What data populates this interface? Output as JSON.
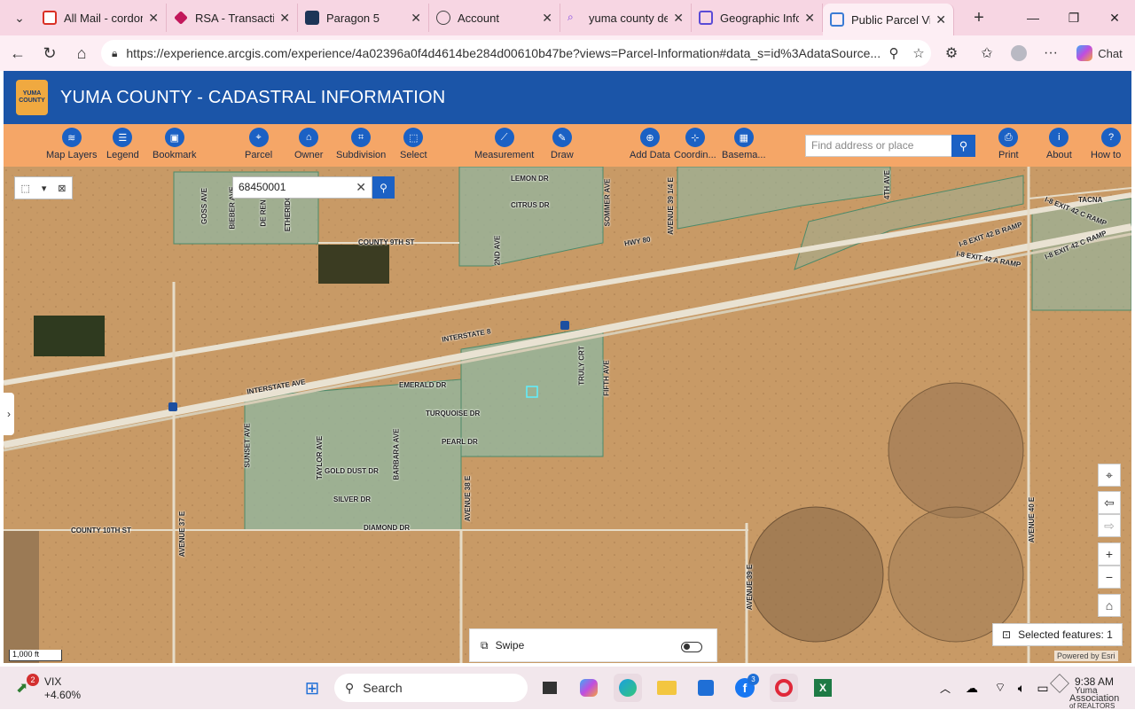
{
  "browser": {
    "tabs": [
      {
        "label": "All Mail - cordom",
        "icon": "gmail-icon",
        "color": "#d93025"
      },
      {
        "label": "RSA - Transaction",
        "icon": "rsa-icon",
        "color": "#c2185b"
      },
      {
        "label": "Paragon 5",
        "icon": "paragon-icon",
        "color": "#1d3557"
      },
      {
        "label": "Account",
        "icon": "globe-icon",
        "color": "#555555"
      },
      {
        "label": "yuma county dev",
        "icon": "search-icon",
        "color": "#7b3fe4"
      },
      {
        "label": "Geographic Infor",
        "icon": "window-icon",
        "color": "#5a4bd6"
      },
      {
        "label": "Public Parcel Vie",
        "icon": "window-icon",
        "color": "#3a7bd5"
      }
    ],
    "url": "https://experience.arcgis.com/experience/4a02396a0f4d4614be284d00610b47be?views=Parcel-Information#data_s=id%3AdataSource...",
    "chat_label": "Chat"
  },
  "app": {
    "logo_text": "YUMA COUNTY",
    "title": "YUMA COUNTY - CADASTRAL INFORMATION",
    "tools": [
      "Map Layers",
      "Legend",
      "Bookmark",
      "Parcel",
      "Owner",
      "Subdivision",
      "Select",
      "Measurement",
      "Draw",
      "Add Data",
      "Coordin...",
      "Basema...",
      "Print",
      "About",
      "How to ..."
    ],
    "address_placeholder": "Find address or place",
    "accent": "#1b61c4",
    "toolbar_color": "#f5a667",
    "header_color": "#1b55a8"
  },
  "map": {
    "parcel_search_value": "68450001",
    "road_labels": [
      "LEMON DR",
      "CITRUS DR",
      "GOSS AVE",
      "BIEBER AVE",
      "DE REN",
      "ETHERIDG",
      "COUNTY 9TH ST",
      "2ND AVE",
      "SOMMER AVE",
      "AVENUE 39 1/4 E",
      "4TH AVE",
      "HWY 80",
      "TACNA",
      "I-8 EXIT 42 C RAMP",
      "I-8 EXIT 42 B RAMP",
      "I-8 EXIT 42 A RAMP",
      "I-8 EXIT 42 C RAMP",
      "INTERSTATE 8",
      "INTERSTATE AVE",
      "EMERALD DR",
      "TRULY CRT",
      "FIFTH AVE",
      "TURQUOISE DR",
      "PEARL DR",
      "SUNSET AVE",
      "TAYLOR AVE",
      "BARBARA AVE",
      "GOLD DUST DR",
      "SILVER DR",
      "DIAMOND DR",
      "COUNTY 10TH ST",
      "AVENUE 37 E",
      "AVENUE 38 E",
      "AVENUE 39 E",
      "AVENUE 40 E"
    ],
    "swipe_label": "Swipe",
    "selected_features": "Selected features: 1",
    "scale": "1,000 ft",
    "powered_by": "Powered by Esri"
  },
  "taskbar": {
    "vix_label": "VIX",
    "vix_change": "+4.60%",
    "vix_badge": "2",
    "search_label": "Search",
    "fb_badge": "3",
    "time": "9:38 AM",
    "tray_text_1": "Yuma",
    "tray_text_2": "Association",
    "tray_text_3": "of REALTORS"
  }
}
